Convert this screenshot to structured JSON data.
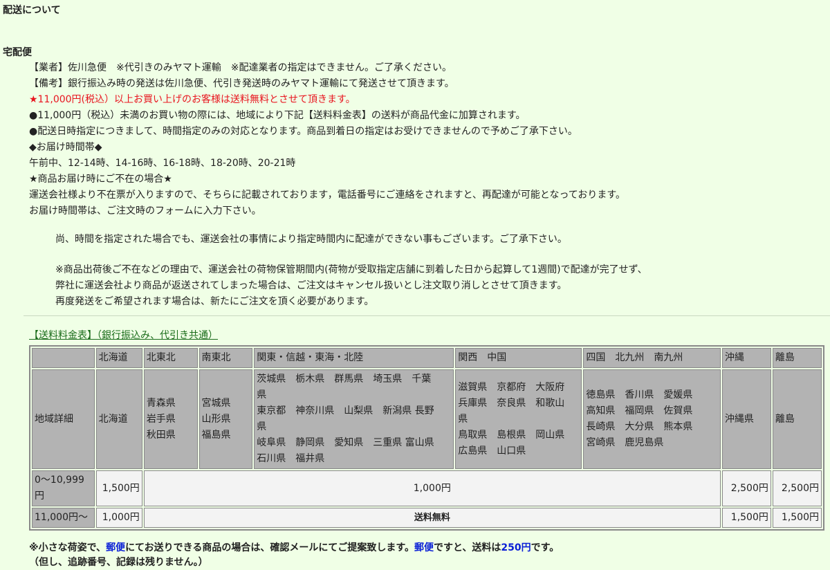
{
  "title": "配送について",
  "section_title": "宅配便",
  "lines": {
    "carrier": "【業者】佐川急便　※代引きのみヤマト運輸　※配達業者の指定はできません。ご了承ください。",
    "remarks": "【備考】銀行振込み時の発送は佐川急便、代引き発送時のみヤマト運輸にて発送させて頂きます。",
    "free_shipping": "★11,000円(税込）以上お買い上げのお客様は送料無料とさせて頂きます。",
    "under_threshold": "●11,000円（税込）未満のお買い物の際には、地域により下記【送料料金表】の送料が商品代金に加算されます。",
    "delivery_time": "●配送日時指定につきまして、時間指定のみの対応となります。商品到着日の指定はお受けできませんので予めご了承下さい。",
    "time_slots_heading": "◆お届け時間帯◆",
    "time_slots": "午前中、12-14時、14-16時、16-18時、18-20時、20-21時",
    "absent_heading": "★商品お届け時にご不在の場合★",
    "absent_1": "運送会社様より不在票が入りますので、そちらに記載されております，電話番号にご連絡をされますと、再配達が可能となっております。",
    "absent_2": "お届け時間帯は、ご注文時のフォームに入力下さい。",
    "note_1": "尚、時間を指定された場合でも、運送会社の事情により指定時間内に配達ができない事もございます。ご了承下さい。",
    "note_2a": "※商品出荷後ご不在などの理由で、運送会社の荷物保管期間内(荷物が受取指定店舗に到着した日から起算して1週間)で配達が完了せず、",
    "note_2b": "弊社に運送会社より商品が返送されてしまった場合は、ご注文はキャンセル扱いとし注文取り消しとさせて頂きます。",
    "note_2c": "再度発送をご希望されます場合は、新たにご注文を頂く必要があります。"
  },
  "table_caption": "【送料料金表】（銀行振込み、代引き共通）",
  "table": {
    "headers": [
      "",
      "北海道",
      "北東北",
      "南東北",
      "関東・信越・東海・北陸",
      "関西　中国",
      "四国　北九州　南九州",
      "沖縄",
      "離島"
    ],
    "detail_label": "地域詳細",
    "details": {
      "hokkaido": "北海道",
      "kita_tohoku": [
        "青森県",
        "岩手県",
        "秋田県"
      ],
      "minami_tohoku": [
        "宮城県",
        "山形県",
        "福島県"
      ],
      "kanto": [
        "茨城県　栃木県　群馬県　埼玉県　千葉",
        "県",
        "東京都　神奈川県　山梨県　新潟県 長野",
        "県",
        "岐阜県　静岡県　愛知県　三重県 富山県",
        "石川県　福井県"
      ],
      "kansai": [
        "滋賀県　京都府　大阪府",
        "兵庫県　奈良県　和歌山",
        "県",
        "鳥取県　島根県　岡山県",
        "広島県　山口県"
      ],
      "shikoku": [
        "徳島県　香川県　愛媛県",
        "高知県　福岡県　佐賀県",
        "長崎県　大分県　熊本県",
        "宮崎県　鹿児島県"
      ],
      "okinawa": "沖縄県",
      "ritou": "離島"
    },
    "row1": {
      "label": "0〜10,999円",
      "hokkaido": "1,500円",
      "mid": "1,000円",
      "okinawa": "2,500円",
      "ritou": "2,500円"
    },
    "row2": {
      "label": "11,000円〜",
      "hokkaido": "1,000円",
      "mid": "送料無料",
      "okinawa": "1,500円",
      "ritou": "1,500円"
    }
  },
  "footer": {
    "p1": "※小さな荷姿で、",
    "yubin1": "郵便",
    "p2": "にてお送りできる商品の場合は、確認メールにてご提案致します。",
    "yubin2": "郵便",
    "p3": "ですと、送料は",
    "price": "250円",
    "p4": "です。",
    "line2": "（但し、追跡番号、記録は残りません。）"
  },
  "colors": {
    "background": "#f0ffe6",
    "accent_red": "#e8141e",
    "accent_blue": "#0a1fd6",
    "table_header": "#b3b3b3"
  }
}
